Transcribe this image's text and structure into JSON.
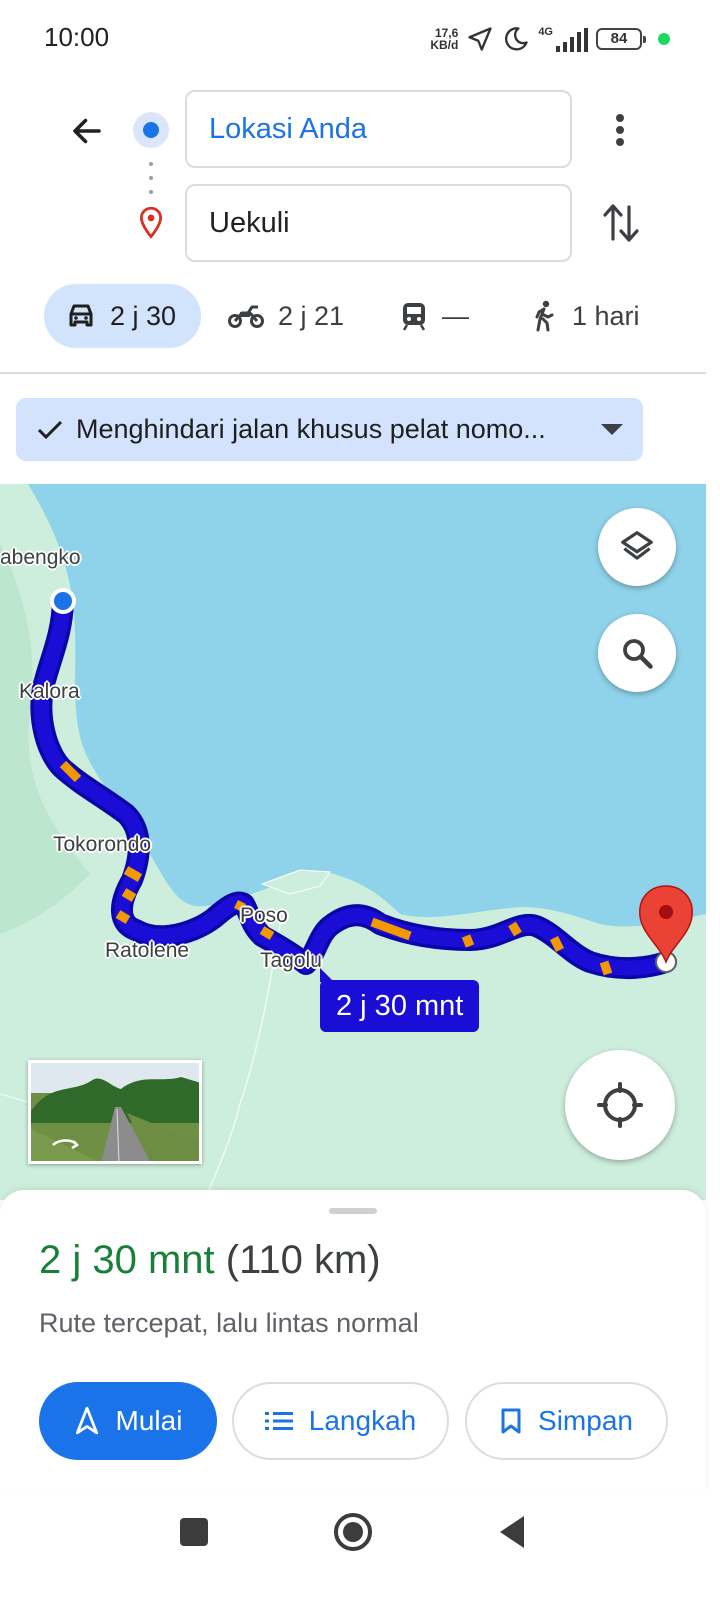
{
  "status_bar": {
    "time": "10:00",
    "net_speed_value": "17,6",
    "net_speed_unit": "KB/d",
    "network_type": "4G",
    "battery_level": "84"
  },
  "directions": {
    "origin": "Lokasi Anda",
    "destination": "Uekuli"
  },
  "modes": [
    {
      "name": "car",
      "label": "2 j 30",
      "selected": true
    },
    {
      "name": "motorbike",
      "label": "2 j 21",
      "selected": false
    },
    {
      "name": "transit",
      "label": "—",
      "selected": false
    },
    {
      "name": "walk",
      "label": "1 hari",
      "selected": false
    }
  ],
  "avoid_chip": {
    "label": "Menghindari jalan khusus pelat nomo..."
  },
  "map": {
    "places": [
      "abengko",
      "Kalora",
      "Tokorondo",
      "Ratolene",
      "Poso",
      "Tagolu"
    ],
    "route_time_label": "2 j 30 mnt",
    "colors": {
      "water": "#8fd3ea",
      "land": "#cdeedd",
      "route": "#1a0dd6",
      "traffic": "#f29900",
      "destination_pin": "#ea4335"
    }
  },
  "sheet": {
    "duration": "2 j 30 mnt",
    "distance": "(110 km)",
    "description": "Rute tercepat, lalu lintas normal",
    "start_label": "Mulai",
    "steps_label": "Langkah",
    "save_label": "Simpan"
  },
  "nav_bar": {
    "buttons": [
      "recents-icon",
      "home-icon",
      "back-icon"
    ]
  }
}
